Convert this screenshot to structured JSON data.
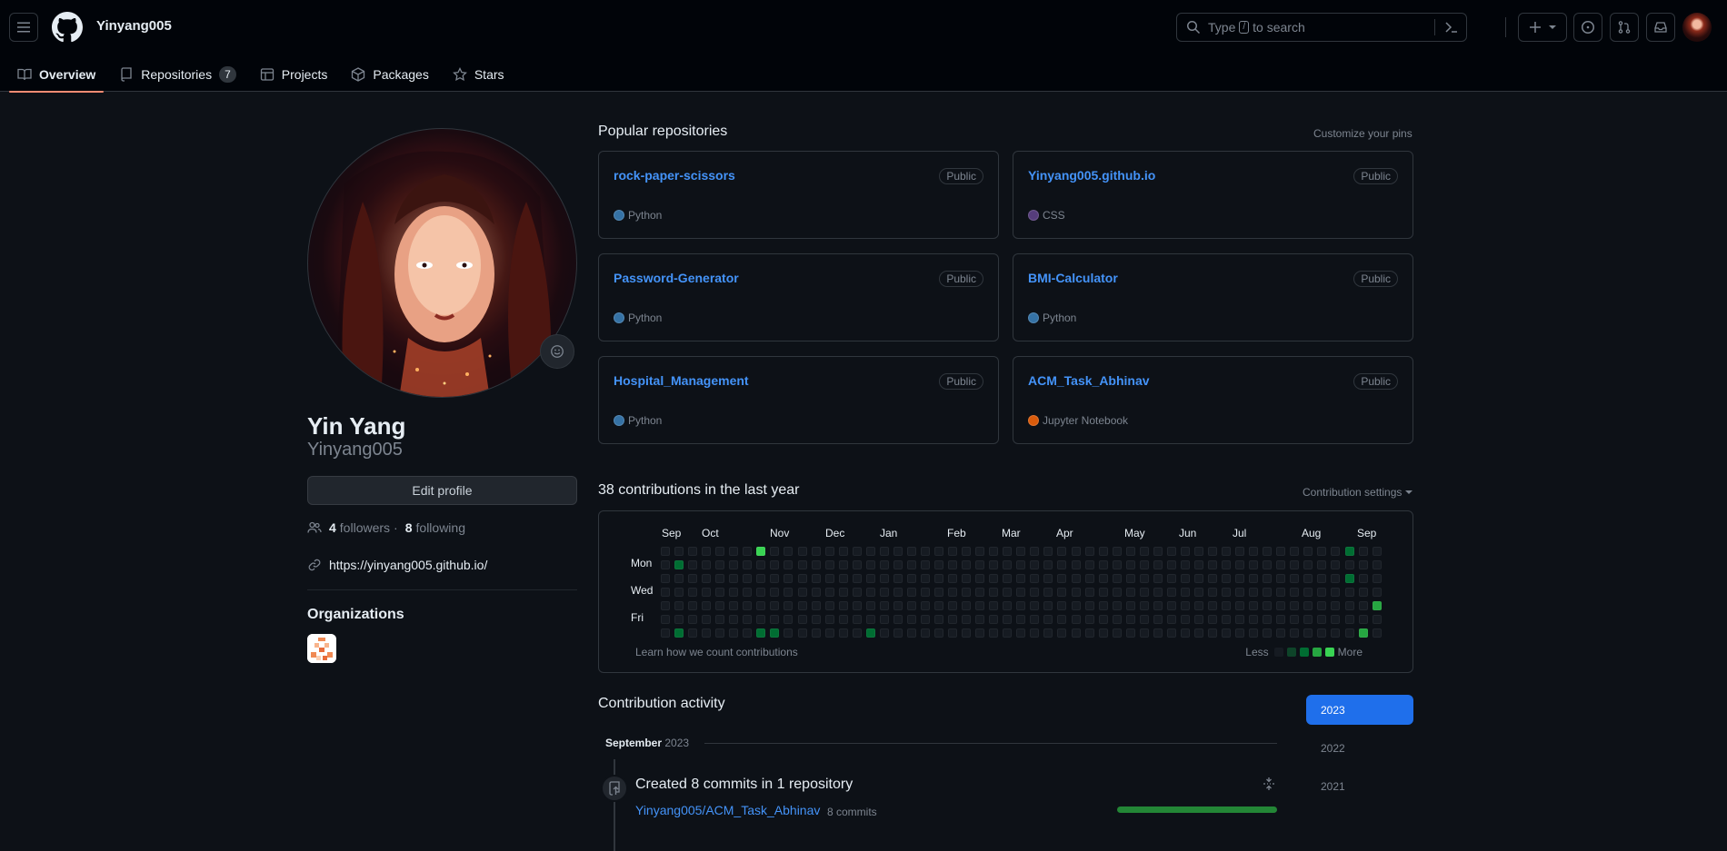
{
  "header": {
    "context_title": "Yinyang005",
    "search": {
      "prefix": "Type",
      "key": "/",
      "suffix": "to search"
    },
    "icons": [
      "hamburger-icon",
      "github-logo",
      "search-icon",
      "command-palette-icon",
      "plus-icon",
      "issues-icon",
      "pull-requests-icon",
      "inbox-icon"
    ]
  },
  "tabs": [
    {
      "label": "Overview",
      "icon": "book-icon",
      "active": true
    },
    {
      "label": "Repositories",
      "icon": "repo-icon",
      "count": "7"
    },
    {
      "label": "Projects",
      "icon": "table-icon"
    },
    {
      "label": "Packages",
      "icon": "package-icon"
    },
    {
      "label": "Stars",
      "icon": "star-icon"
    }
  ],
  "profile": {
    "full_name": "Yin Yang",
    "username": "Yinyang005",
    "edit_label": "Edit profile",
    "followers_count": "4",
    "followers_label": "followers",
    "sep": "·",
    "following_count": "8",
    "following_label": "following",
    "website": "https://yinyang005.github.io/",
    "orgs_title": "Organizations"
  },
  "popular": {
    "title": "Popular repositories",
    "customize": "Customize your pins",
    "repos": [
      {
        "name": "rock-paper-scissors",
        "badge": "Public",
        "lang": "Python",
        "color": "#3572A5"
      },
      {
        "name": "Yinyang005.github.io",
        "badge": "Public",
        "lang": "CSS",
        "color": "#563d7c"
      },
      {
        "name": "Password-Generator",
        "badge": "Public",
        "lang": "Python",
        "color": "#3572A5"
      },
      {
        "name": "BMI-Calculator",
        "badge": "Public",
        "lang": "Python",
        "color": "#3572A5"
      },
      {
        "name": "Hospital_Management",
        "badge": "Public",
        "lang": "Python",
        "color": "#3572A5"
      },
      {
        "name": "ACM_Task_Abhinav",
        "badge": "Public",
        "lang": "Jupyter Notebook",
        "color": "#DA5B0B"
      }
    ]
  },
  "contributions": {
    "title": "38 contributions in the last year",
    "settings": "Contribution settings",
    "months": [
      "Sep",
      "Oct",
      "Nov",
      "Dec",
      "Jan",
      "Feb",
      "Mar",
      "Apr",
      "May",
      "Jun",
      "Jul",
      "Aug",
      "Sep"
    ],
    "days": [
      "Mon",
      "Wed",
      "Fri"
    ],
    "footer": "Learn how we count contributions",
    "legend_less": "Less",
    "legend_more": "More",
    "levels": [
      "#161b22",
      "#0e4429",
      "#006d32",
      "#26a641",
      "#39d353"
    ],
    "weeks": 53,
    "active_cells": [
      {
        "week": 1,
        "day": 1,
        "level": 2
      },
      {
        "week": 1,
        "day": 6,
        "level": 2
      },
      {
        "week": 7,
        "day": 0,
        "level": 4
      },
      {
        "week": 7,
        "day": 6,
        "level": 2
      },
      {
        "week": 8,
        "day": 6,
        "level": 2
      },
      {
        "week": 15,
        "day": 6,
        "level": 2
      },
      {
        "week": 50,
        "day": 0,
        "level": 2
      },
      {
        "week": 50,
        "day": 2,
        "level": 2
      },
      {
        "week": 51,
        "day": 6,
        "level": 3
      },
      {
        "week": 52,
        "day": 4,
        "level": 3
      }
    ]
  },
  "activity": {
    "title": "Contribution activity",
    "years": [
      "2023",
      "2022",
      "2021"
    ],
    "selected_year": "2023",
    "month": "September",
    "month_year": "2023",
    "summary": "Created 8 commits in 1 repository",
    "repo": "Yinyang005/ACM_Task_Abhinav",
    "commits": "8 commits"
  }
}
